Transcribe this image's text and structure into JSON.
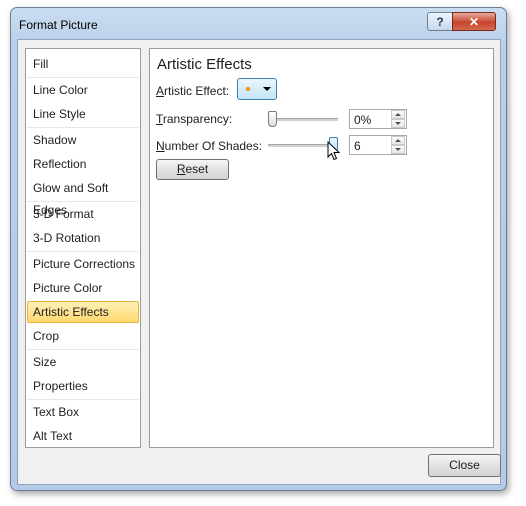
{
  "window": {
    "title": "Format Picture",
    "help_label": "?",
    "close_label": "✕"
  },
  "nav": {
    "items": [
      {
        "label": "Fill"
      },
      {
        "label": "Line Color"
      },
      {
        "label": "Line Style"
      },
      {
        "label": "Shadow"
      },
      {
        "label": "Reflection"
      },
      {
        "label": "Glow and Soft Edges"
      },
      {
        "label": "3-D Format"
      },
      {
        "label": "3-D Rotation"
      },
      {
        "label": "Picture Corrections"
      },
      {
        "label": "Picture Color"
      },
      {
        "label": "Artistic Effects",
        "selected": true
      },
      {
        "label": "Crop"
      },
      {
        "label": "Size"
      },
      {
        "label": "Properties"
      },
      {
        "label": "Text Box"
      },
      {
        "label": "Alt Text"
      }
    ]
  },
  "panel": {
    "title": "Artistic Effects",
    "artistic_effect": {
      "label_key": "A",
      "label_rest": "rtistic Effect:",
      "icon": "paint-dot-icon",
      "accent_color": "#f28a17"
    },
    "transparency": {
      "label_key": "T",
      "label_rest": "ransparency:",
      "value": "0%",
      "slider_level": 0
    },
    "shades": {
      "label_key": "N",
      "label_rest": "umber Of Shades:",
      "value": "6",
      "slider_level": 1
    },
    "reset": {
      "label_key": "R",
      "label_rest": "eset"
    }
  },
  "footer": {
    "close_label": "Close"
  }
}
